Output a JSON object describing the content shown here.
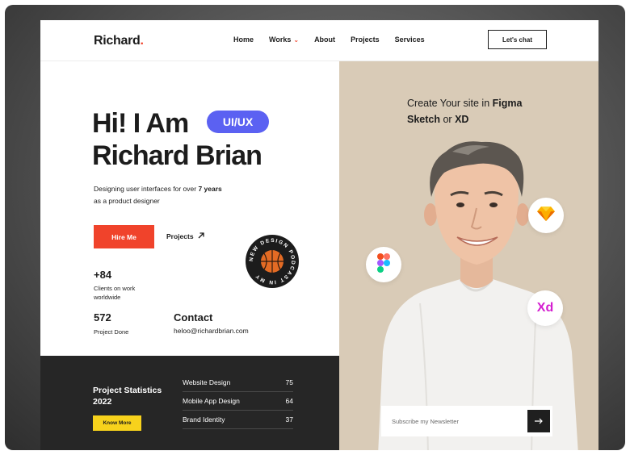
{
  "nav": {
    "logo": "Richard",
    "logo_dot": ".",
    "links": [
      "Home",
      "Works",
      "About",
      "Projects",
      "Services"
    ],
    "cta": "Let's chat"
  },
  "hero": {
    "line1": "Hi! I Am",
    "line2": "Richard Brian",
    "pill": "UI/UX",
    "tagline_pre": "Designing user interfaces for over ",
    "tagline_bold": "7 years",
    "tagline_post": "as a product designer",
    "hire_label": "Hire Me",
    "projects_label": "Projects",
    "badge_text": "NEW DESIGN PODCAST IN MY"
  },
  "stats": {
    "clients_value": "+84",
    "clients_label": "Clients on work worldwide",
    "projects_value": "572",
    "projects_label": "Project Done"
  },
  "contact": {
    "heading": "Contact",
    "email": "heloo@richardbrian.com"
  },
  "project_stats": {
    "title": "Project Statistics 2022",
    "button": "Know More",
    "rows": [
      {
        "name": "Website Design",
        "value": "75"
      },
      {
        "name": "Mobile App Design",
        "value": "64"
      },
      {
        "name": "Brand Identity",
        "value": "37"
      }
    ]
  },
  "right": {
    "create_pre": "Create Your site in ",
    "figma": "Figma",
    "sketch": "Sketch",
    "or": " or ",
    "xd": "XD",
    "xd_badge": "Xd",
    "newsletter_placeholder": "Subscribe my Newsletter"
  },
  "colors": {
    "accent": "#f0432b",
    "pill": "#5b61f2",
    "beige": "#d9cbb7",
    "dark": "#262626",
    "yellow": "#f7d21c"
  }
}
